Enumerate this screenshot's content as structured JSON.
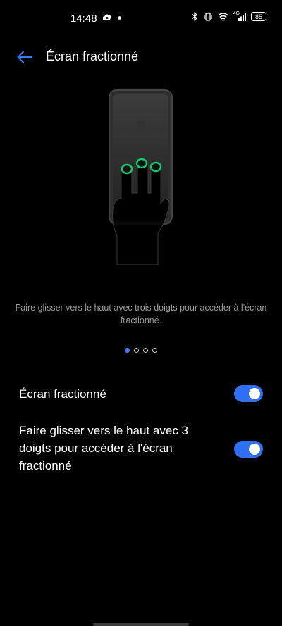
{
  "status_bar": {
    "time": "14:48",
    "battery": "85",
    "signal_label": "4G",
    "icons": [
      "cloud-eye-icon",
      "dot-icon",
      "bluetooth-icon",
      "vibrate-icon",
      "wifi-icon",
      "signal-icon",
      "battery-icon"
    ]
  },
  "header": {
    "title": "Écran fractionné",
    "back_icon": "arrow-left-icon"
  },
  "illustration": {
    "description_icon": "three-finger-swipe-icon"
  },
  "gesture_description": "Faire glisser vers le haut avec trois doigts pour accéder à l'écran fractionné.",
  "pager": {
    "count": 4,
    "active_index": 0
  },
  "settings": [
    {
      "label": "Écran fractionné",
      "enabled": true
    },
    {
      "label": "Faire glisser vers le haut avec 3 doigts pour accéder à l'écran fractionné",
      "enabled": true
    }
  ],
  "colors": {
    "background": "#000000",
    "accent": "#2f6ff3",
    "back_arrow": "#3d7bf5",
    "finger_glow": "#19c46a",
    "secondary_text": "#9a9a9a"
  }
}
